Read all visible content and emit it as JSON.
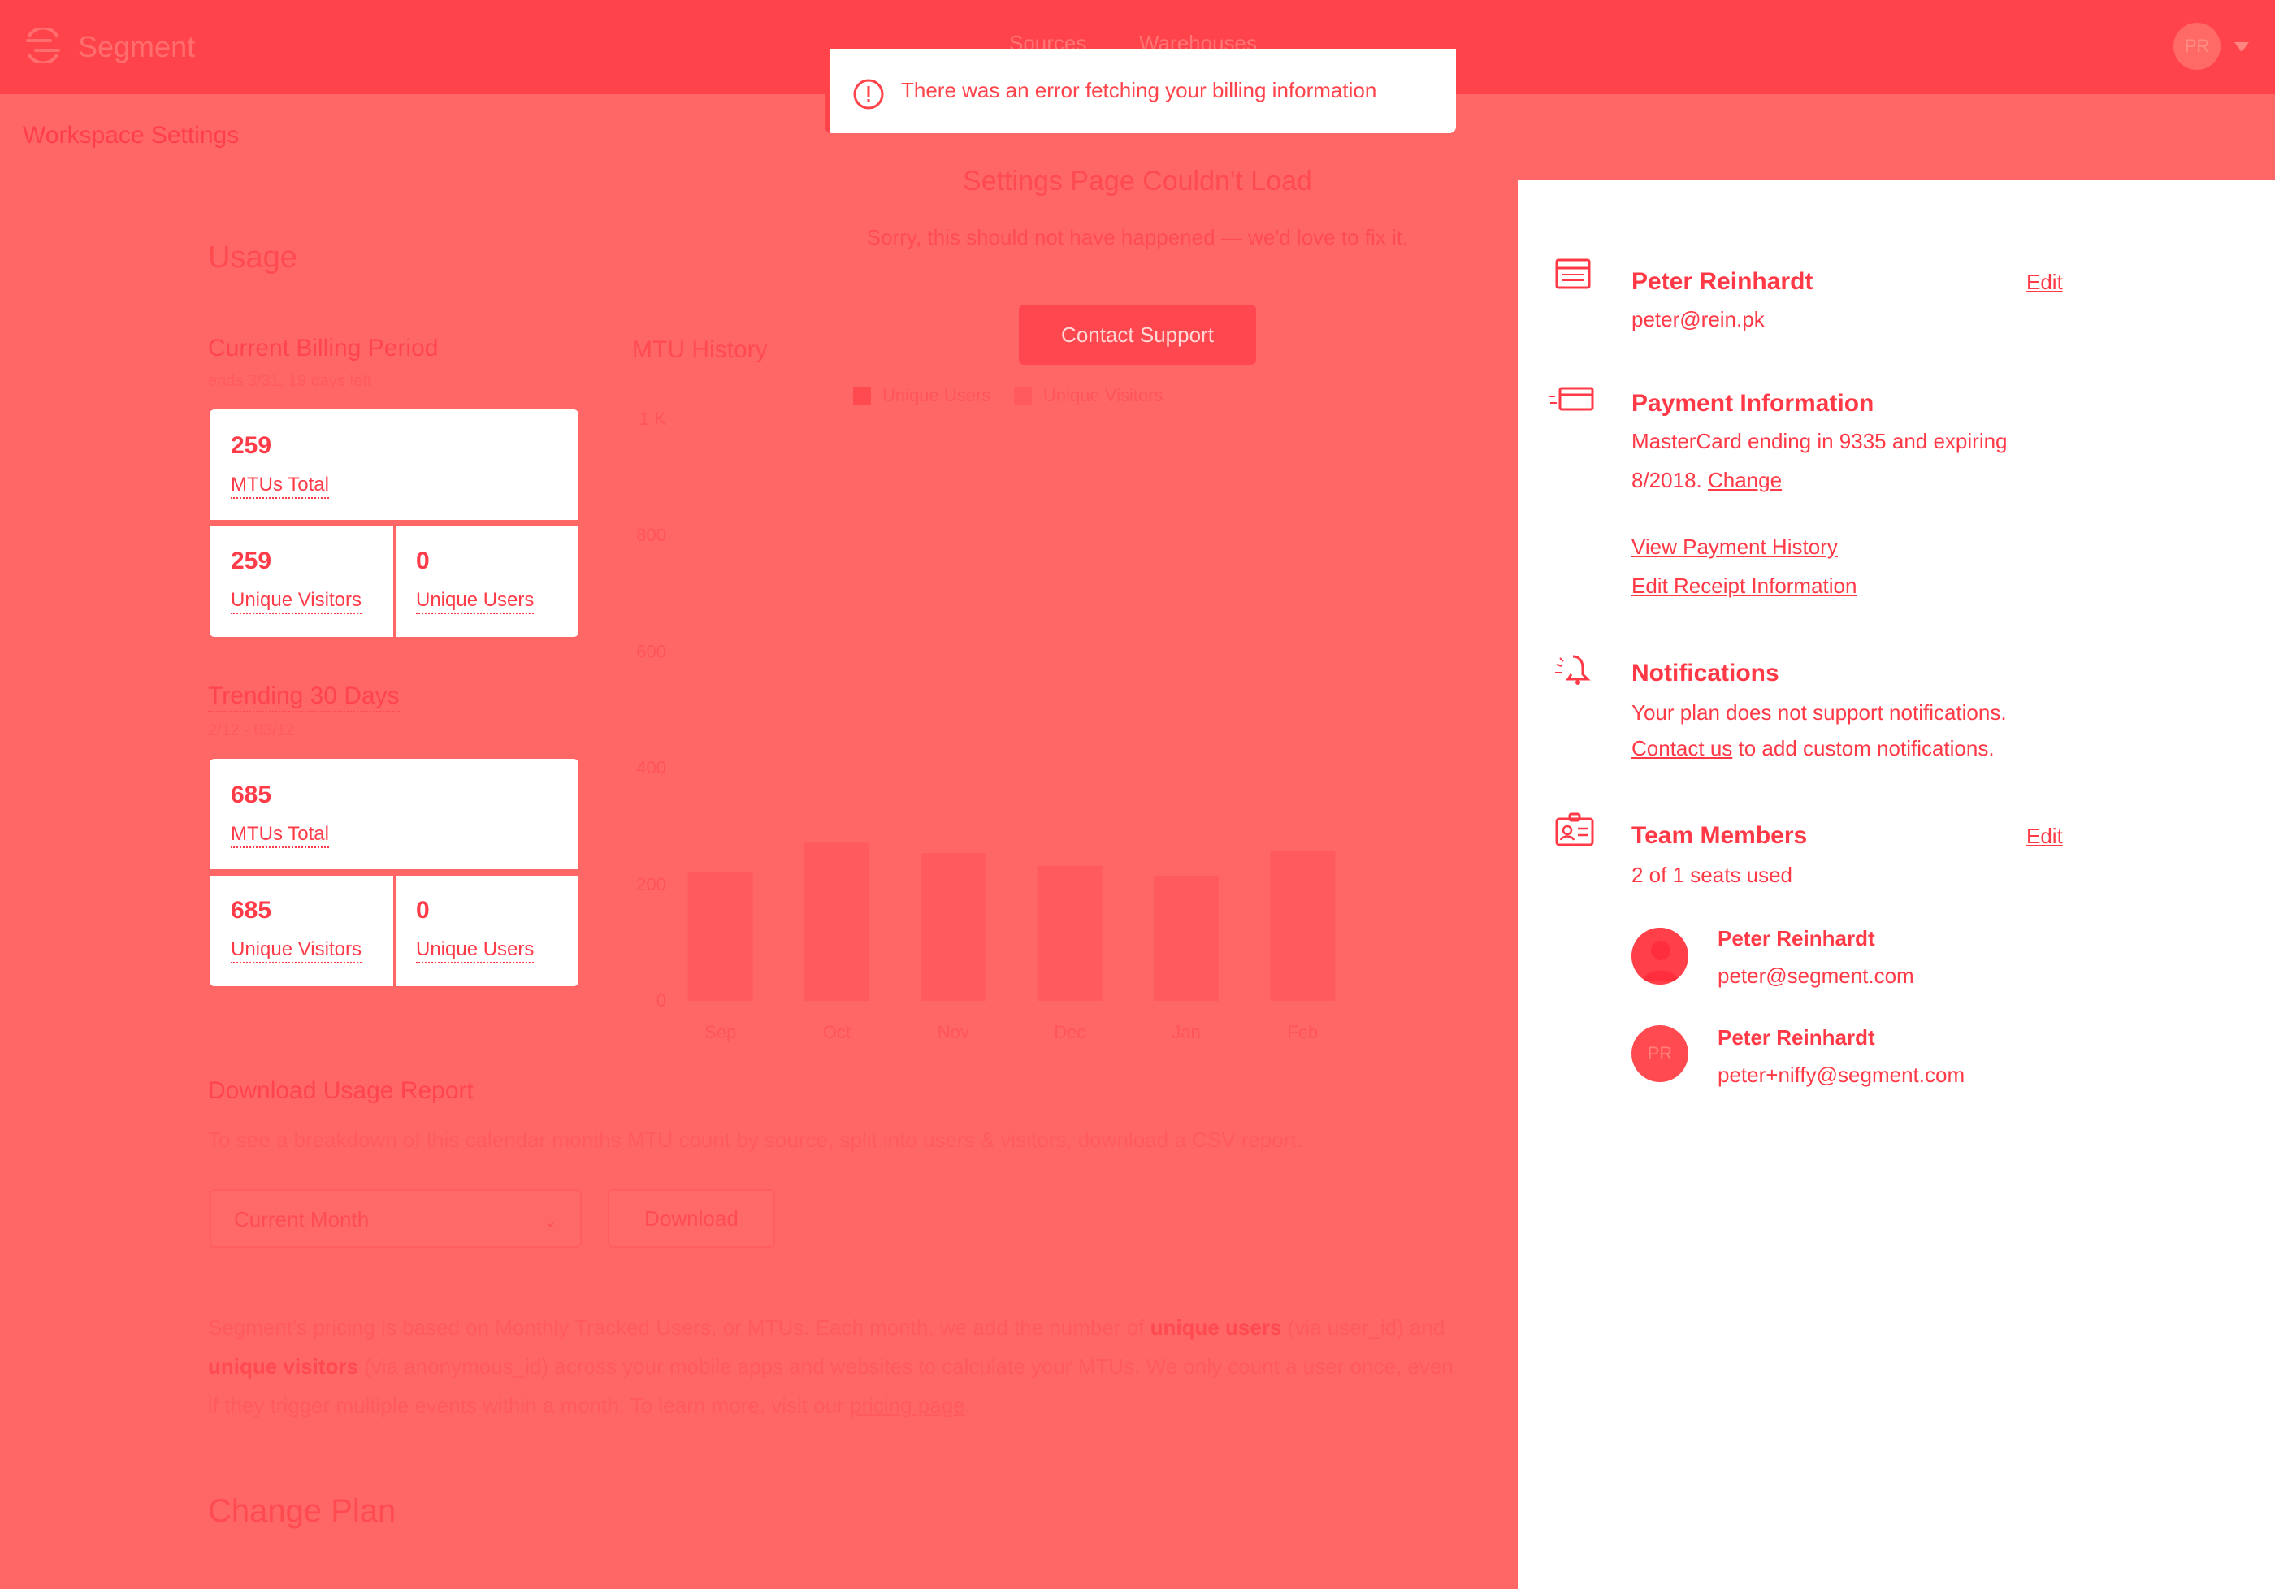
{
  "app": {
    "name": "Segment"
  },
  "nav": {
    "items": [
      "Sources",
      "Warehouses"
    ]
  },
  "user": {
    "initials": "PR"
  },
  "toast": {
    "message": "There was an error fetching your billing information"
  },
  "page": {
    "title": "Workspace Settings"
  },
  "error_state": {
    "title": "Settings Page Couldn't Load",
    "subtitle": "Sorry, this should not have happened — we'd love to fix it.",
    "button": "Contact Support"
  },
  "usage": {
    "heading": "Usage",
    "current_period": {
      "title": "Current Billing Period",
      "subtitle": "ends 3/31, 19 days left",
      "total": "259",
      "total_label": "MTUs Total",
      "visitors": "259",
      "visitors_label": "Unique Visitors",
      "users": "0",
      "users_label": "Unique Users"
    },
    "trending": {
      "title": "Trending 30 Days",
      "subtitle": "2/12 - 03/12",
      "total": "685",
      "total_label": "MTUs Total",
      "visitors": "685",
      "visitors_label": "Unique Visitors",
      "users": "0",
      "users_label": "Unique Users"
    }
  },
  "chart_data": {
    "type": "bar",
    "title": "MTU History",
    "categories": [
      "Sep",
      "Oct",
      "Nov",
      "Dec",
      "Jan",
      "Feb"
    ],
    "series": [
      {
        "name": "Unique Users",
        "values": [
          0,
          0,
          0,
          0,
          0,
          0
        ]
      },
      {
        "name": "Unique Visitors",
        "values": [
          222,
          272,
          254,
          232,
          215,
          258
        ]
      }
    ],
    "yticks": [
      "0",
      "200",
      "400",
      "600",
      "800",
      "1 K"
    ],
    "ylim": [
      0,
      1000
    ],
    "legend": "top",
    "colors": {
      "Unique Users": "#ff4a50",
      "Unique Visitors": "#ff5a5e"
    }
  },
  "download": {
    "heading": "Download Usage Report",
    "description": "To see a breakdown of this calendar months MTU count by source, split into users & visitors, download a CSV report.",
    "select_value": "Current Month",
    "button": "Download"
  },
  "pricing": {
    "p1": "Segment's pricing is based on Monthly Tracked Users, or MTUs. Each month, we add the number of ",
    "b1": "unique users",
    "p2": " (via user_id) and ",
    "b2": "unique visitors",
    "p3": " (via anonymous_id) across your mobile apps and websites to calculate your MTUs. We only count a user once, even if they trigger multiple events within a month. To learn more, visit our ",
    "link": "pricing page",
    "p4": "."
  },
  "change_plan": {
    "heading": "Change Plan"
  },
  "panel": {
    "account": {
      "name": "Peter Reinhardt",
      "email": "peter@rein.pk",
      "edit": "Edit"
    },
    "payment": {
      "title": "Payment Information",
      "line1": "MasterCard ending in 9335 and expiring",
      "line2": "8/2018.",
      "change": "Change",
      "history": "View Payment History",
      "receipt": "Edit Receipt Information"
    },
    "notifications": {
      "title": "Notifications",
      "line1": "Your plan does not support notifications.",
      "contact": "Contact us",
      "line2": " to add custom notifications."
    },
    "team": {
      "title": "Team Members",
      "edit": "Edit",
      "seats": "2 of 1 seats used",
      "members": [
        {
          "name": "Peter Reinhardt",
          "email": "peter@segment.com",
          "initials": ""
        },
        {
          "name": "Peter Reinhardt",
          "email": "peter+niffy@segment.com",
          "initials": "PR"
        }
      ]
    }
  },
  "colors": {
    "brand": "#ff434b",
    "overlay": "#ff6766",
    "panel": "#ffffff",
    "text": "#ff3946"
  }
}
